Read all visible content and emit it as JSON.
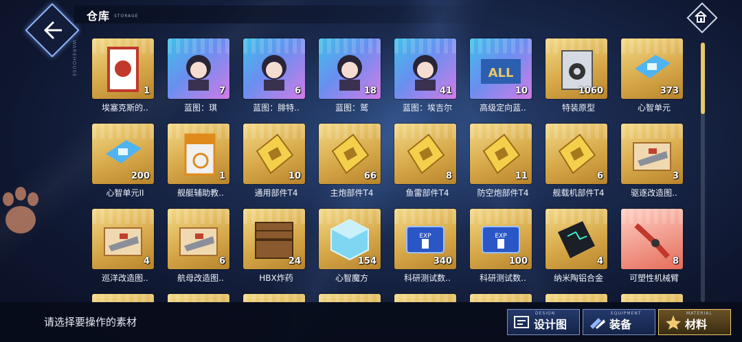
{
  "header": {
    "title": "仓库",
    "subtitle": "STORAGE",
    "rail_text": "WAREHOUSE"
  },
  "items": [
    {
      "name": "埃塞克斯的..",
      "count": "1",
      "style": "gold",
      "icon": "new-year-card-icon"
    },
    {
      "name": "蓝图：琪",
      "count": "7",
      "style": "blue",
      "icon": "blueprint-icon"
    },
    {
      "name": "蓝图：腓特..",
      "count": "6",
      "style": "blue",
      "icon": "blueprint-icon"
    },
    {
      "name": "蓝图：鹫",
      "count": "18",
      "style": "blue",
      "icon": "blueprint-icon"
    },
    {
      "name": "蓝图：埃吉尔",
      "count": "41",
      "style": "blue",
      "icon": "blueprint-icon"
    },
    {
      "name": "高级定向蓝..",
      "count": "10",
      "style": "blue",
      "icon": "blueprint-all-icon"
    },
    {
      "name": "特装原型",
      "count": "1060",
      "style": "gold",
      "icon": "prototype-icon"
    },
    {
      "name": "心智单元",
      "count": "373",
      "style": "gold",
      "icon": "cognitive-chip-icon"
    },
    {
      "name": "心智单元II",
      "count": "200",
      "style": "gold",
      "icon": "cognitive-chip-icon"
    },
    {
      "name": "舰艇辅助教..",
      "count": "1",
      "style": "gold",
      "icon": "skill-book-icon"
    },
    {
      "name": "通用部件T4",
      "count": "10",
      "style": "gold",
      "icon": "plate-icon"
    },
    {
      "name": "主炮部件T4",
      "count": "66",
      "style": "gold",
      "icon": "plate-icon"
    },
    {
      "name": "鱼雷部件T4",
      "count": "8",
      "style": "gold",
      "icon": "plate-icon"
    },
    {
      "name": "防空炮部件T4",
      "count": "11",
      "style": "gold",
      "icon": "plate-icon"
    },
    {
      "name": "舰载机部件T4",
      "count": "6",
      "style": "gold",
      "icon": "plate-icon"
    },
    {
      "name": "驱逐改造图..",
      "count": "3",
      "style": "gold",
      "icon": "retrofit-blueprint-icon"
    },
    {
      "name": "巡洋改造图..",
      "count": "4",
      "style": "gold",
      "icon": "retrofit-blueprint-icon"
    },
    {
      "name": "航母改造图..",
      "count": "6",
      "style": "gold",
      "icon": "retrofit-blueprint-icon"
    },
    {
      "name": "HBX炸药",
      "count": "24",
      "style": "gold",
      "icon": "crate-icon"
    },
    {
      "name": "心智魔方",
      "count": "154",
      "style": "gold",
      "icon": "wisdom-cube-icon"
    },
    {
      "name": "科研测试数..",
      "count": "340",
      "style": "gold",
      "icon": "exp-data-icon"
    },
    {
      "name": "科研测试数..",
      "count": "100",
      "style": "gold",
      "icon": "exp-data-icon"
    },
    {
      "name": "纳米陶铝合金",
      "count": "4",
      "style": "gold",
      "icon": "circuit-board-icon"
    },
    {
      "name": "可塑性机械臂",
      "count": "8",
      "style": "red",
      "icon": "robot-arm-icon"
    },
    {
      "name": "",
      "count": "",
      "style": "gold",
      "icon": "partial-item-icon"
    },
    {
      "name": "",
      "count": "",
      "style": "gold",
      "icon": "partial-item-icon"
    },
    {
      "name": "",
      "count": "",
      "style": "gold",
      "icon": "partial-item-icon"
    },
    {
      "name": "",
      "count": "",
      "style": "gold",
      "icon": "partial-item-icon"
    },
    {
      "name": "",
      "count": "",
      "style": "gold",
      "icon": "partial-item-icon"
    },
    {
      "name": "",
      "count": "",
      "style": "gold",
      "icon": "partial-item-icon"
    },
    {
      "name": "",
      "count": "",
      "style": "gold",
      "icon": "partial-item-icon"
    },
    {
      "name": "",
      "count": "",
      "style": "gold",
      "icon": "partial-item-icon"
    }
  ],
  "footer": {
    "hint": "请选择要操作的素材",
    "tabs": [
      {
        "label": "设计图",
        "sub": "DESIGN",
        "active": false
      },
      {
        "label": "装备",
        "sub": "EQUIPMENT",
        "active": false
      },
      {
        "label": "材料",
        "sub": "MATERIAL",
        "active": true
      }
    ]
  },
  "colors": {
    "accent_gold": "#f0c970",
    "accent_blue": "#8fb6ff",
    "background": "#1a2a4e"
  }
}
